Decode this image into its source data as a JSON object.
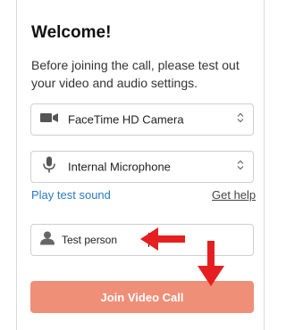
{
  "header": {
    "title": "Welcome!",
    "subtitle": "Before joining the call, please test out your video and audio settings."
  },
  "camera_select": {
    "value": "FaceTime HD Camera",
    "icon": "video-camera-icon"
  },
  "microphone_select": {
    "value": "Internal Microphone",
    "icon": "microphone-icon"
  },
  "links": {
    "play_test_sound": "Play test sound",
    "get_help": "Get help"
  },
  "name_field": {
    "value": "Test person",
    "icon": "person-icon"
  },
  "join_button": {
    "label": "Join Video Call"
  },
  "colors": {
    "accent_button": "#ef8f78",
    "link_blue": "#2a7ac0",
    "annotation_red": "#e51f1f"
  }
}
